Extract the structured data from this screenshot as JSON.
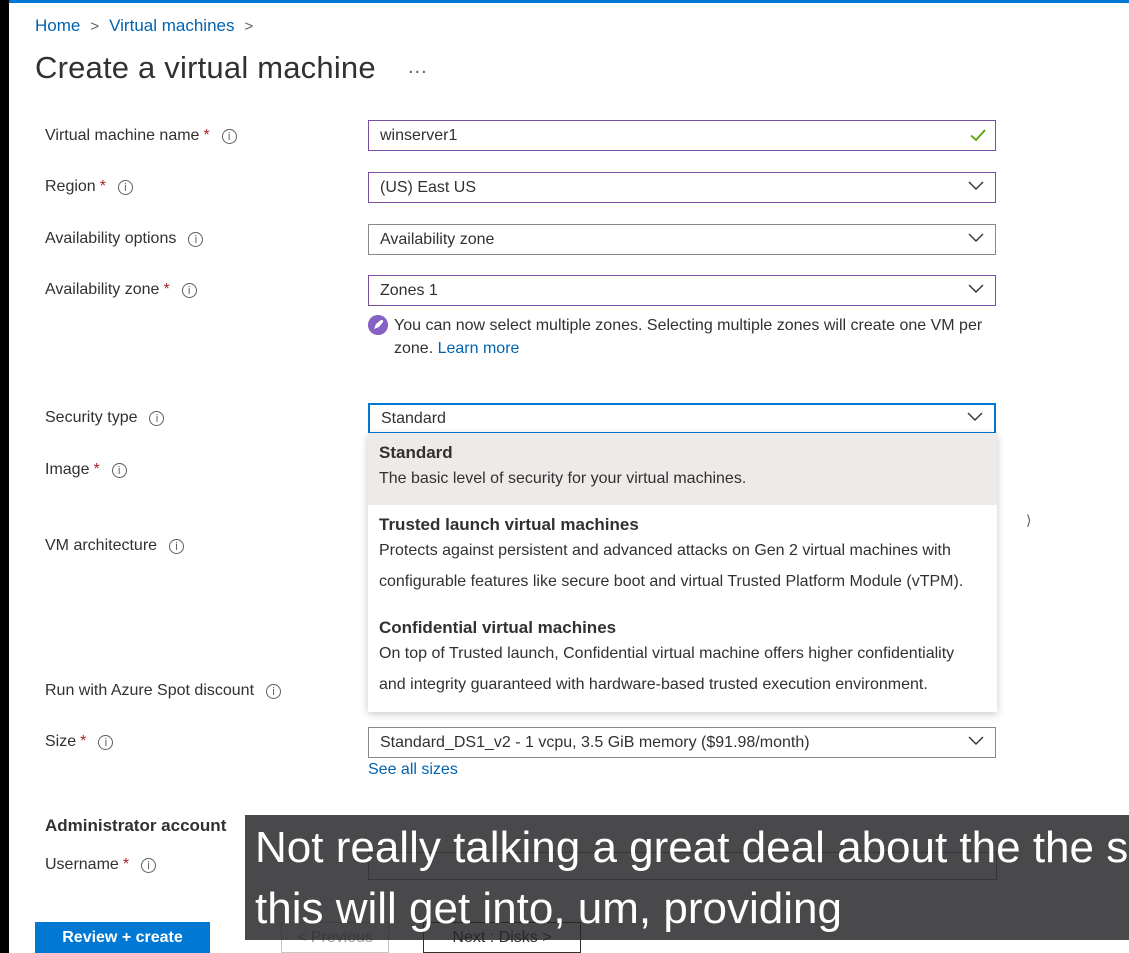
{
  "breadcrumb": {
    "home": "Home",
    "parent": "Virtual machines",
    "separator": ">"
  },
  "page": {
    "title": "Create a virtual machine",
    "more": "..."
  },
  "form": {
    "vm_name": {
      "label": "Virtual machine name",
      "value": "winserver1",
      "valid": true
    },
    "region": {
      "label": "Region",
      "value": "(US) East US"
    },
    "availability_options": {
      "label": "Availability options",
      "value": "Availability zone"
    },
    "availability_zone": {
      "label": "Availability zone",
      "value": "Zones 1"
    },
    "zone_notice": {
      "text": "You can now select multiple zones. Selecting multiple zones will create one VM per zone.",
      "link": "Learn more"
    },
    "security_type": {
      "label": "Security type",
      "value": "Standard"
    },
    "image": {
      "label": "Image"
    },
    "vm_architecture": {
      "label": "VM architecture"
    },
    "spot": {
      "label": "Run with Azure Spot discount"
    },
    "size": {
      "label": "Size",
      "value": "Standard_DS1_v2 - 1 vcpu, 3.5 GiB memory ($91.98/month)",
      "link": "See all sizes"
    },
    "required_marker": "*",
    "info_symbol": "i"
  },
  "security_dropdown": {
    "options": [
      {
        "title": "Standard",
        "desc": [
          "The basic level of security for your virtual machines."
        ],
        "selected": true
      },
      {
        "title": "Trusted launch virtual machines",
        "desc": [
          "Protects against persistent and advanced attacks on Gen 2 virtual machines with",
          "configurable features like secure boot and virtual Trusted Platform Module (vTPM)."
        ]
      },
      {
        "title": "Confidential virtual machines",
        "desc": [
          "On top of Trusted launch, Confidential virtual machine offers higher confidentiality",
          "and integrity guaranteed with hardware-based trusted execution environment."
        ]
      }
    ]
  },
  "admin": {
    "heading": "Administrator account",
    "username_label": "Username"
  },
  "footer": {
    "review": "Review + create",
    "previous": "< Previous",
    "next": "Next : Disks >"
  },
  "caption": {
    "line1": "Not really talking a great deal about the the se",
    "line2": "this will get into, um, providing"
  },
  "colors": {
    "accent": "#0078d4",
    "link": "#0063b1",
    "required": "#a4262c",
    "valid": "#57a300",
    "notice": "#8661c5",
    "caption_bg": "#26262a"
  },
  "icons": {
    "chevron": "chevron-down-icon",
    "check": "checkmark-icon",
    "rocket": "rocket-icon",
    "info": "info-icon"
  }
}
